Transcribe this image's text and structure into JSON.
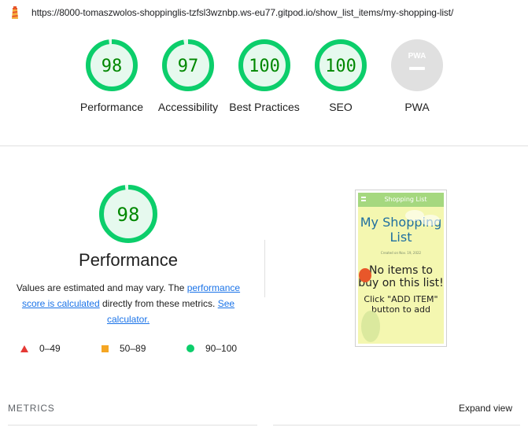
{
  "browser": {
    "url": "https://8000-tomaszwolos-shoppinglis-tzfsl3wznbp.ws-eu77.gitpod.io/show_list_items/my-shopping-list/"
  },
  "gauges": [
    {
      "label": "Performance",
      "score": "98",
      "fraction": 0.98
    },
    {
      "label": "Accessibility",
      "score": "97",
      "fraction": 0.97
    },
    {
      "label": "Best Practices",
      "score": "100",
      "fraction": 1.0
    },
    {
      "label": "SEO",
      "score": "100",
      "fraction": 1.0
    },
    {
      "label": "PWA",
      "badge": "PWA"
    }
  ],
  "performance": {
    "score": "98",
    "fraction": 0.98,
    "title": "Performance",
    "desc_1": "Values are estimated and may vary. The ",
    "link_1": "performance score is calculated",
    "desc_2": " directly from these metrics. ",
    "link_2": "See calculator."
  },
  "legend": [
    {
      "range": "0–49",
      "color": "#e53935",
      "shape": "triangle"
    },
    {
      "range": "50–89",
      "color": "#f5a623",
      "shape": "square"
    },
    {
      "range": "90–100",
      "color": "#0cce6b",
      "shape": "circle"
    }
  ],
  "screenshot": {
    "nav_title": "Shopping List",
    "title": "My Shopping List",
    "date": "Created on Nov. 19, 2022",
    "message": "No items to buy on this list!",
    "hint": "Click \"ADD ITEM\" button to add"
  },
  "metrics": {
    "title": "METRICS",
    "expand": "Expand view"
  },
  "colors": {
    "pass": "#0cce6b",
    "pass_text": "#008800",
    "pass_bg": "#e6f9ee",
    "pwa_grey": "#e0e0e0"
  }
}
